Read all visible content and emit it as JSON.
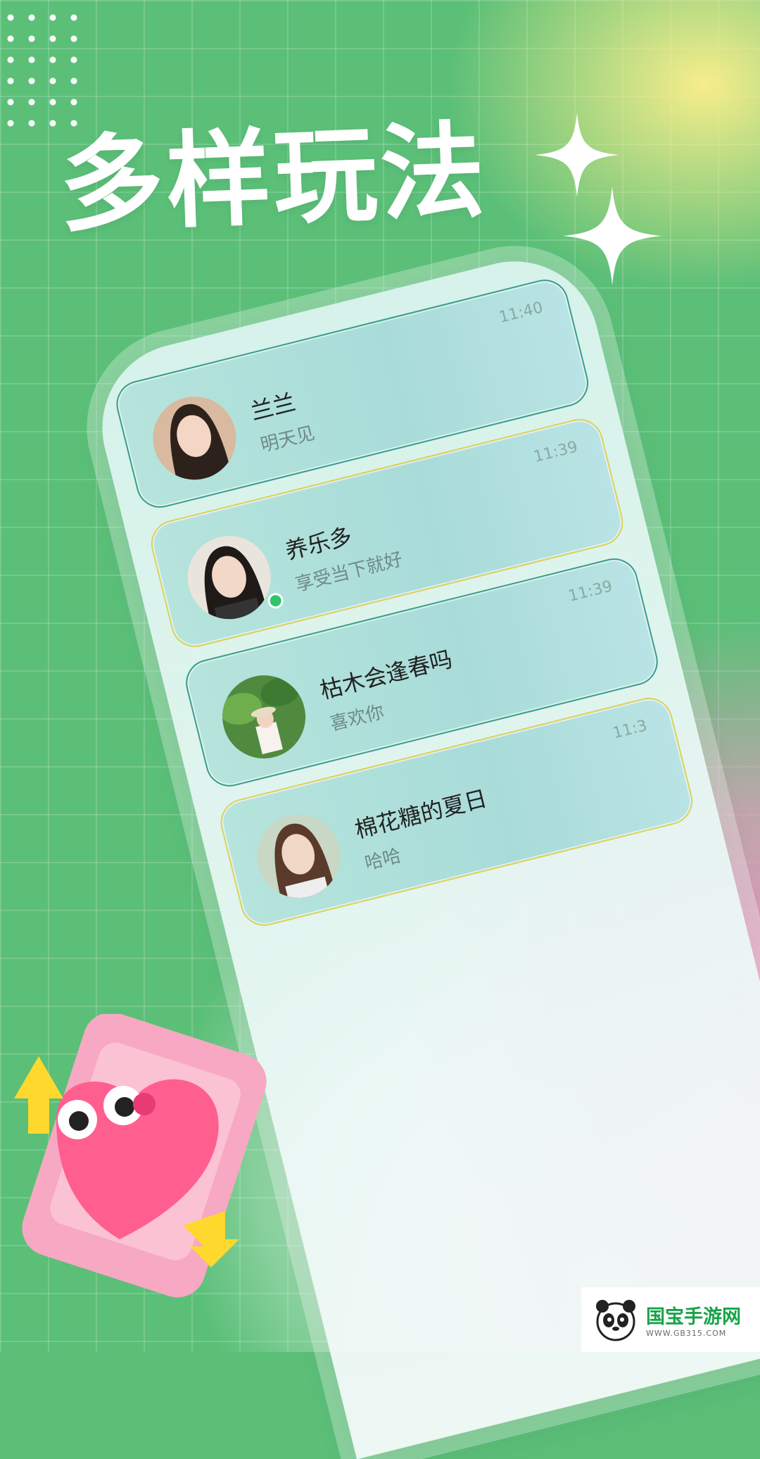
{
  "headline": "多样玩法",
  "chats": [
    {
      "name": "兰兰",
      "preview": "明天见",
      "time": "11:40",
      "border": "teal",
      "online": false
    },
    {
      "name": "养乐多",
      "preview": "享受当下就好",
      "time": "11:39",
      "border": "gold",
      "online": true
    },
    {
      "name": "枯木会逢春吗",
      "preview": "喜欢你",
      "time": "11:39",
      "border": "teal",
      "online": false
    },
    {
      "name": "棉花糖的夏日",
      "preview": "哈哈",
      "time": "11:3",
      "border": "gold",
      "online": false
    }
  ],
  "watermark": {
    "title": "国宝手游网",
    "subtitle": "WWW.GB315.COM"
  },
  "colors": {
    "background": "#5bbf78",
    "accent_green": "#2ec66b",
    "pink": "#ff8cc8",
    "yellow": "#fff08c"
  }
}
